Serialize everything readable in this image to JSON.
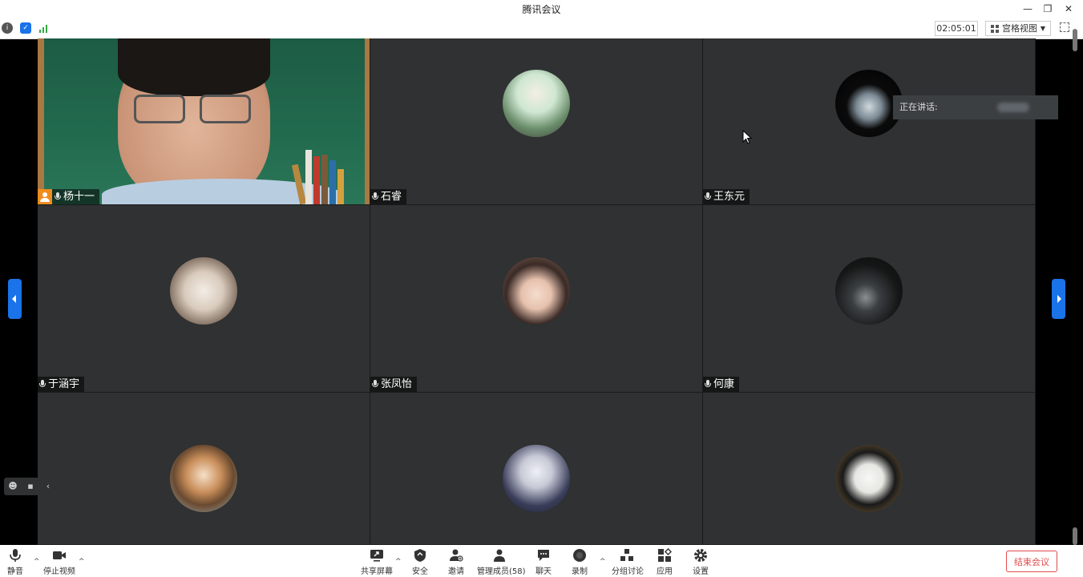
{
  "window": {
    "title": "腾讯会议",
    "minimize": "—",
    "restore": "❐",
    "close": "✕"
  },
  "infobar": {
    "timer": "02:05:01",
    "view_label": "宫格视图",
    "view_caret": "▼"
  },
  "tiles": [
    {
      "name": "杨十一",
      "type": "camera",
      "host": true
    },
    {
      "name": "石睿",
      "type": "avatar",
      "avatar_icon": "anime-girl-hat-avatar"
    },
    {
      "name": "王东元",
      "type": "avatar",
      "avatar_icon": "moon-night-avatar"
    },
    {
      "name": "于涵宇",
      "type": "avatar",
      "avatar_icon": "white-dog-avatar"
    },
    {
      "name": "张凤怡",
      "type": "avatar",
      "avatar_icon": "girl-photo-avatar"
    },
    {
      "name": "何康",
      "type": "avatar",
      "avatar_icon": "dark-moon-avatar"
    },
    {
      "name": "",
      "type": "avatar",
      "avatar_icon": "anime-boy-sailor-avatar"
    },
    {
      "name": "",
      "type": "avatar",
      "avatar_icon": "anime-silver-hair-avatar"
    },
    {
      "name": "",
      "type": "avatar",
      "avatar_icon": "panda-avatar"
    }
  ],
  "speaking": {
    "label": "正在讲话:"
  },
  "toolbar": {
    "mute": "静音",
    "stop_video": "停止视频",
    "share_screen": "共享屏幕",
    "security": "安全",
    "invite": "邀请",
    "manage_members": "管理成员(58)",
    "chat": "聊天",
    "record": "录制",
    "breakout": "分组讨论",
    "apps": "应用",
    "settings": "设置",
    "end_meeting": "结束会议"
  },
  "colors": {
    "accent": "#1a73e8",
    "end": "#e04b4b",
    "tile_bg": "#2f3132",
    "host_badge": "#f08c1e"
  }
}
